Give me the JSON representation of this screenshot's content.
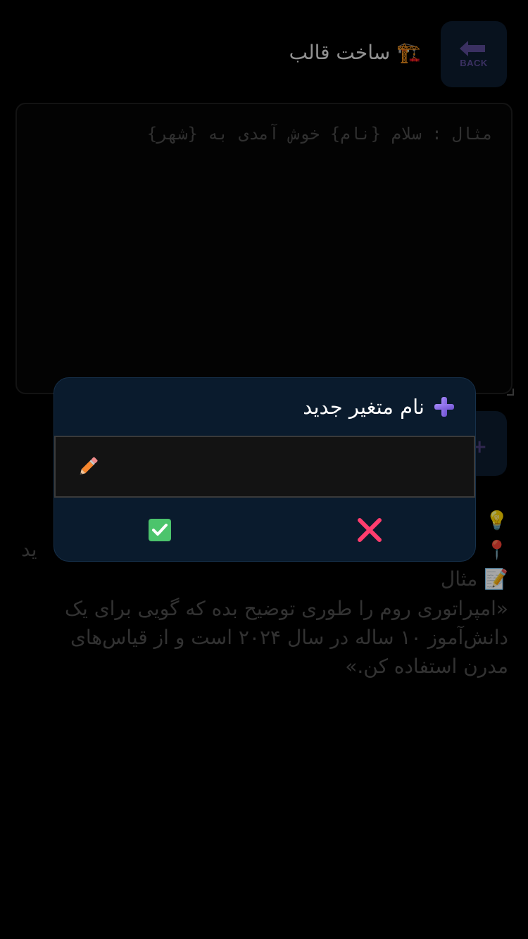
{
  "header": {
    "back_label": "BACK",
    "title": "🏗️ ساخت قالب"
  },
  "editor": {
    "placeholder": "مثال : سلام {نام} خوش آمدی به {شهر}",
    "value": ""
  },
  "help": {
    "tip_emoji": "💡",
    "pin_emoji": "📍",
    "pin_text_fragment": "ید",
    "example_label": "📝 مثال",
    "example_text": "«امپراتوری روم را طوری توضیح بده که گویی برای یک دانش‌آموز ۱۰ ساله در سال ۲۰۲۴ است و از قیاس‌های مدرن استفاده کن.»"
  },
  "modal": {
    "title": "نام متغیر جدید",
    "input_value": "",
    "input_placeholder": ""
  },
  "colors": {
    "background": "#000000",
    "modal_bg": "#0a1b2d",
    "accent_purple": "#8b6fe0",
    "confirm_green": "#4cc46c",
    "cancel_pink": "#ff3d6e"
  }
}
